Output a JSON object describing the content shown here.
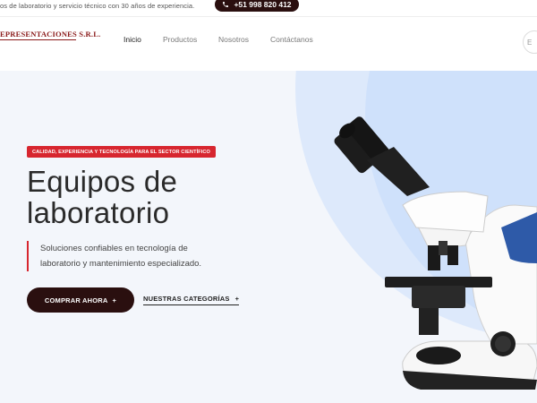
{
  "topbar": {
    "text": "os de laboratorio y servicio técnico con 30 años de experiencia.",
    "phone": "+51 998 820 412"
  },
  "header": {
    "logo": "EPRESENTACIONES S.R.L.",
    "nav": [
      "Inicio",
      "Productos",
      "Nosotros",
      "Contáctanos"
    ],
    "active_nav": "Inicio"
  },
  "hero": {
    "badge": "CALIDAD, EXPERIENCIA Y TECNOLOGÍA PARA EL SECTOR CIENTÍFICO",
    "title_line1": "Equipos de",
    "title_line2": "laboratorio",
    "desc_line1": "Soluciones confiables en tecnología de",
    "desc_line2": "laboratorio y mantenimiento especializado.",
    "cta_primary": "COMPRAR AHORA",
    "cta_primary_icon": "+",
    "cta_secondary": "NUESTRAS CATEGORÍAS",
    "cta_secondary_icon": "+"
  },
  "colors": {
    "brand_dark": "#2a0f0f",
    "accent_red": "#d7262f",
    "hero_bg": "#f3f6fb",
    "hero_circle": "#dde9fb"
  }
}
